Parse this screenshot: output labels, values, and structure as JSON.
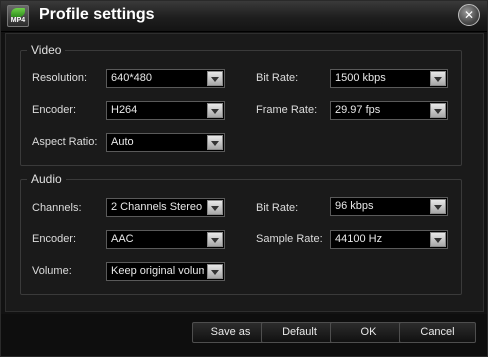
{
  "window": {
    "title": "Profile settings",
    "app_icon_text": "MP4"
  },
  "video": {
    "legend": "Video",
    "resolution": {
      "label": "Resolution:",
      "value": "640*480"
    },
    "bit_rate": {
      "label": "Bit Rate:",
      "value": "1500 kbps"
    },
    "encoder": {
      "label": "Encoder:",
      "value": "H264"
    },
    "frame_rate": {
      "label": "Frame Rate:",
      "value": "29.97 fps"
    },
    "aspect_ratio": {
      "label": "Aspect Ratio:",
      "value": "Auto"
    }
  },
  "audio": {
    "legend": "Audio",
    "channels": {
      "label": "Channels:",
      "value": "2 Channels Stereo"
    },
    "bit_rate": {
      "label": "Bit Rate:",
      "value": "96 kbps"
    },
    "encoder": {
      "label": "Encoder:",
      "value": "AAC"
    },
    "sample_rate": {
      "label": "Sample Rate:",
      "value": "44100 Hz"
    },
    "volume": {
      "label": "Volume:",
      "value": "Keep original volume"
    }
  },
  "buttons": {
    "save_as": "Save as",
    "default": "Default",
    "ok": "OK",
    "cancel": "Cancel"
  },
  "icons": {
    "close": "close-icon",
    "app": "app-icon"
  },
  "colors": {
    "background": "#121212",
    "combo_bg": "#000000",
    "text": "#e6e6e6"
  }
}
